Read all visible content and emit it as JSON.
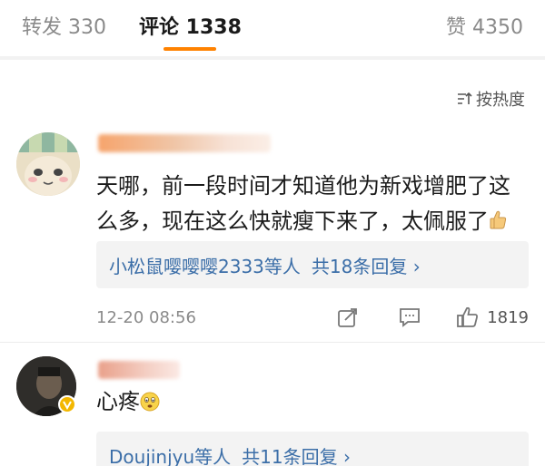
{
  "tabs": {
    "repost": "转发 330",
    "comment": "评论 1338",
    "like": "赞 4350"
  },
  "sort": {
    "label": "按热度"
  },
  "comments": [
    {
      "text_line1": "天哪，前一段时间才知道他为新戏增肥了这",
      "text_line2": "么多，现在这么快就瘦下来了，太佩服了",
      "reply_users": "小松鼠嘤嘤嘤2333等人",
      "reply_count": "共18条回复 ›",
      "time": "12-20 08:56",
      "likes": "1819"
    },
    {
      "text": "心疼",
      "reply_users": "Doujinjyu等人",
      "reply_count": "共11条回复 ›"
    }
  ],
  "colors": {
    "accent": "#ff8200",
    "link": "#3b6ea8",
    "muted": "#8a8a8a"
  },
  "icons": [
    "sort-icon",
    "thumbs-up-emoji-icon",
    "worried-face-emoji-icon",
    "share-icon",
    "reply-icon",
    "like-icon",
    "verified-badge-icon"
  ]
}
